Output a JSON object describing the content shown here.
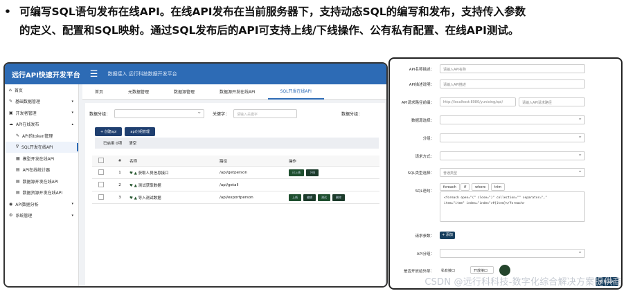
{
  "caption": {
    "bullet": "•",
    "line1": "可编写SQL语句发布在线API。在线API发布在当前服务器下，支持动态SQL的编写和发布，支持传入参数",
    "line2": "的定义、配置和SQL映射。通过SQL发布后的API可支持上线/下线操作、公有私有配置、在线API测试。"
  },
  "app": {
    "title": "远行API快速开发平台",
    "menu_icon": "☰",
    "breadcrumb": "数据接入 远行科技数据开发平台",
    "sidebar": [
      {
        "icon": "home-icon",
        "glyph": "⌂",
        "label": "首页",
        "sub": false
      },
      {
        "icon": "wrench-icon",
        "glyph": "✎",
        "label": "基础数据管理",
        "sub": false,
        "arrow": "▾"
      },
      {
        "icon": "box-icon",
        "glyph": "▣",
        "label": "开发者管理",
        "sub": false,
        "arrow": "▾"
      },
      {
        "icon": "cloud-icon",
        "glyph": "☁",
        "label": "API在线发布",
        "sub": false,
        "arrow": "▴"
      },
      {
        "icon": "pen-icon",
        "glyph": "✎",
        "label": "API的token管理",
        "sub": true
      },
      {
        "icon": "filter-icon",
        "glyph": "∇",
        "label": "SQL开发在线API",
        "sub": true,
        "active": true
      },
      {
        "icon": "grid-icon",
        "glyph": "▦",
        "label": "模型开发在线API",
        "sub": true
      },
      {
        "icon": "doc-icon",
        "glyph": "▤",
        "label": "API在线统计器",
        "sub": true
      },
      {
        "icon": "doc-icon",
        "glyph": "▤",
        "label": "数据源开发在线API",
        "sub": true
      },
      {
        "icon": "doc-icon",
        "glyph": "▤",
        "label": "数据资源开发在线API",
        "sub": true
      },
      {
        "icon": "eye-icon",
        "glyph": "◉",
        "label": "API数据分析",
        "sub": false,
        "arrow": "▾"
      },
      {
        "icon": "gear-icon",
        "glyph": "⚙",
        "label": "系统管理",
        "sub": false,
        "arrow": "▾"
      }
    ],
    "tabs": [
      "首页",
      "元数据管理",
      "数据源管理",
      "数据源开发在线API",
      "SQL开发在线API"
    ],
    "filter": {
      "label1": "数据分组：",
      "label2": "关键字：",
      "placeholder": "请输入关键字",
      "label3": "数据分组："
    },
    "buttons": {
      "create": "+ 创建api",
      "copy": "api分组管理"
    },
    "subtabs": [
      "已启用 0项",
      "清空"
    ],
    "table": {
      "headers": [
        "",
        "#",
        "名称",
        "路径",
        "操作"
      ],
      "rows": [
        {
          "no": "1",
          "name": "获取人员信息接口",
          "path": "/api/getperson",
          "actions": [
            "已上线",
            "下线"
          ]
        },
        {
          "no": "2",
          "name": "测试获取数据",
          "path": "/api/getall",
          "actions": []
        },
        {
          "no": "3",
          "name": "导入测试数据",
          "path": "/api/exportperson",
          "actions": [
            "上线",
            "编辑",
            "测试",
            "删除"
          ]
        }
      ]
    }
  },
  "form": {
    "rows": [
      {
        "label": "API名称描述：",
        "value": "请输入API名称"
      },
      {
        "label": "API描述说明：",
        "value": "请输入API描述"
      },
      {
        "label": "API请求路径前缀：",
        "value": "http://localhost:8080/yunixing/api/",
        "extra": "请输入API请求路径"
      },
      {
        "label": "数据源选择：",
        "value": ""
      },
      {
        "label": "分组：",
        "value": ""
      },
      {
        "label": "请求方式：",
        "value": ""
      },
      {
        "label": "SQL类型选择：",
        "value": "普通类型"
      }
    ],
    "sql_label": "SQL语句：",
    "sql_chips": [
      "foreach",
      "if",
      "where",
      "trim"
    ],
    "sql_text1": "<foreach open=\"(\" close=\")\" collection=\"\" separator=\",\"",
    "sql_text2": " item=\"item\" index=\"index\">#{item}</foreach>",
    "param_label": "请求参数：",
    "param_btn": "+ 添加",
    "api_label": "API分组：",
    "public_label": "是否开放给外部：",
    "public_value": "私有接口",
    "public_btn": "开放接口",
    "corner_btn": "发布API"
  },
  "watermark": "CSDN @远行科科技-数字化综合解决方案提供商"
}
